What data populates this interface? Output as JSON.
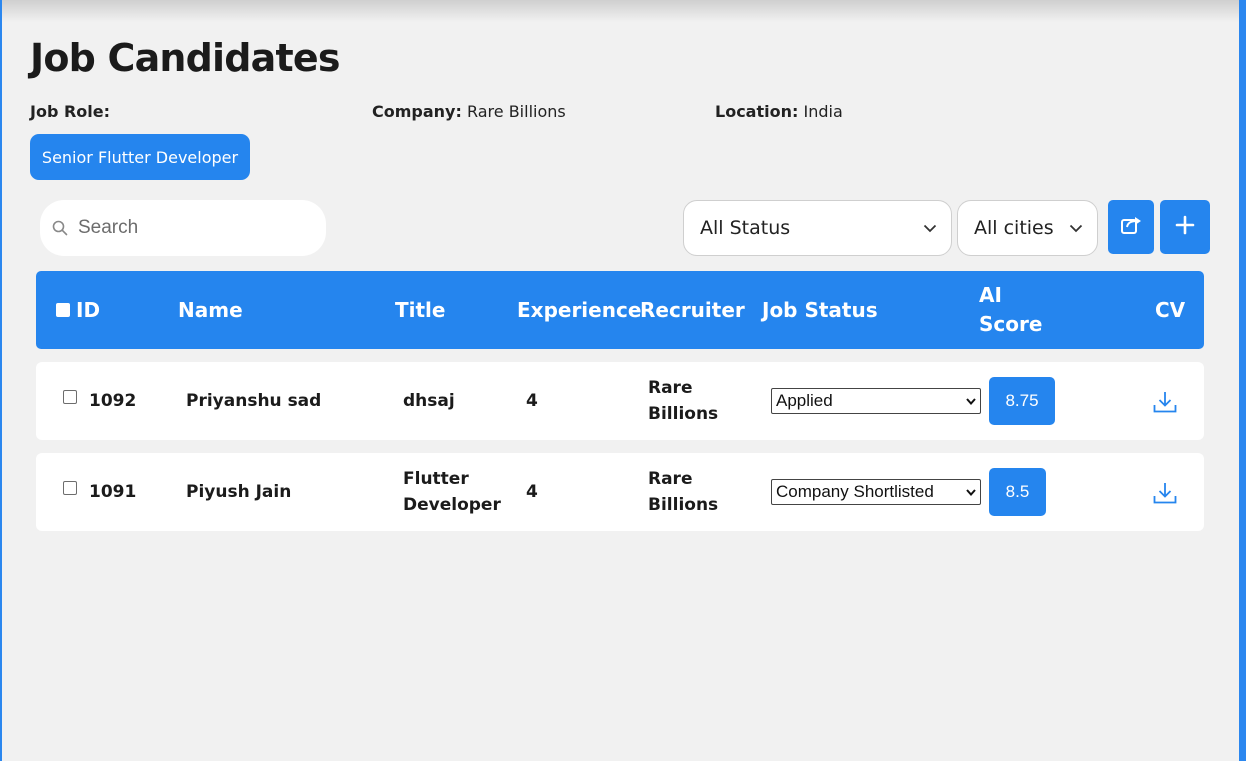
{
  "page": {
    "title": "Job Candidates"
  },
  "meta": {
    "job_role_label": "Job Role:",
    "company_label": "Company:",
    "company_value": "Rare Billions",
    "location_label": "Location:",
    "location_value": "India"
  },
  "job_role_chip": "Senior Flutter Developer",
  "search": {
    "placeholder": "Search",
    "icon": "search-icon"
  },
  "filters": {
    "status": {
      "selected": "All Status",
      "icon": "chevron-down-icon"
    },
    "city": {
      "selected": "All cities",
      "icon": "chevron-down-icon"
    }
  },
  "toolbar": {
    "share_icon": "share-icon",
    "add_icon": "plus-icon"
  },
  "table": {
    "columns": {
      "id": "ID",
      "name": "Name",
      "title": "Title",
      "experience": "Experience",
      "recruiter": "Recruiter",
      "job_status": "Job Status",
      "ai_score_line1": "AI",
      "ai_score_line2": "Score",
      "cv": "CV"
    },
    "rows": [
      {
        "id": "1092",
        "name": "Priyanshu sad",
        "title_line1": "dhsaj",
        "title_line2": "",
        "experience": "4",
        "recruiter_line1": "Rare",
        "recruiter_line2": "Billions",
        "job_status": "Applied",
        "ai_score": "8.75",
        "cv_icon": "download-icon"
      },
      {
        "id": "1091",
        "name": "Piyush Jain",
        "title_line1": "Flutter",
        "title_line2": "Developer",
        "experience": "4",
        "recruiter_line1": "Rare",
        "recruiter_line2": "Billions",
        "job_status": "Company Shortlisted",
        "ai_score": "8.5",
        "cv_icon": "download-icon"
      }
    ]
  },
  "colors": {
    "accent": "#2585ee",
    "background": "#f1f1f1",
    "card": "#ffffff"
  }
}
